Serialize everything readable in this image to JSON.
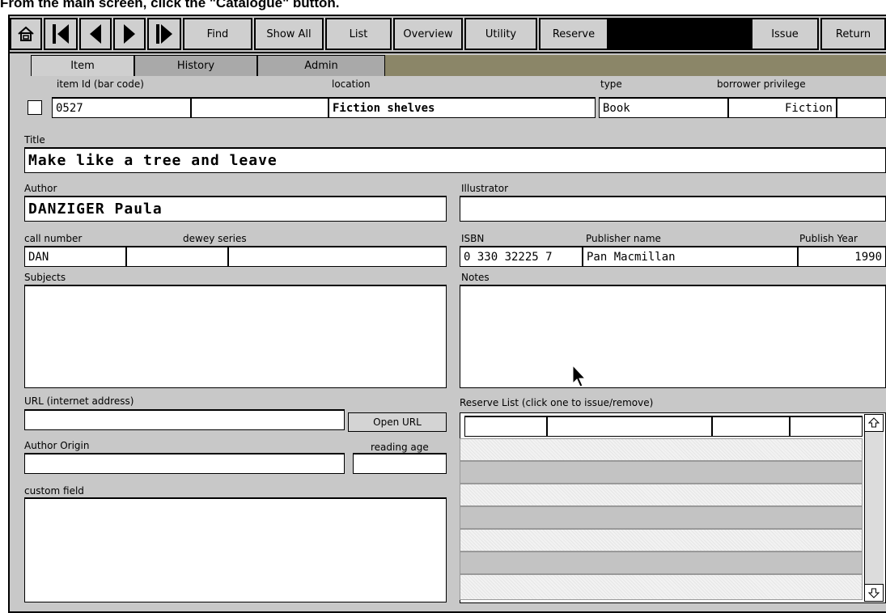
{
  "caption": "From the main screen, click the \"Catalogue\" button.",
  "toolbar": {
    "find": "Find",
    "show_all": "Show All",
    "list": "List",
    "overview": "Overview",
    "utility": "Utility",
    "reserve": "Reserve",
    "issue": "Issue",
    "return": "Return"
  },
  "tabs": {
    "item": "Item",
    "history": "History",
    "admin": "Admin"
  },
  "item": {
    "id_label": "item Id (bar code)",
    "id_value": "0527",
    "location_label": "location",
    "location_value": "Fiction shelves",
    "type_label": "type",
    "type_value": "Book",
    "privilege_label": "borrower privilege",
    "privilege_value": "Fiction"
  },
  "title": {
    "label": "Title",
    "value": "Make like a tree and leave"
  },
  "author": {
    "label": "Author",
    "value": "DANZIGER  Paula"
  },
  "illustrator": {
    "label": "Illustrator",
    "value": ""
  },
  "call": {
    "label": "call number",
    "value": "DAN",
    "dewey_label": "dewey series"
  },
  "isbn": {
    "label": "ISBN",
    "value": "0 330 32225 7"
  },
  "publisher": {
    "label": "Publisher name",
    "value": "Pan Macmillan"
  },
  "year": {
    "label": "Publish Year",
    "value": "1990"
  },
  "subjects": {
    "label": "Subjects"
  },
  "notes": {
    "label": "Notes"
  },
  "url": {
    "label": "URL (internet address)",
    "button": "Open URL"
  },
  "origin": {
    "label": "Author Origin"
  },
  "reading": {
    "label": "reading age"
  },
  "custom": {
    "label": "custom field"
  },
  "reserve_list": {
    "label": "Reserve List (click one to issue/remove)"
  },
  "colors": {
    "window_bg": "#c8c8c8",
    "tab_strip": "#8b8668",
    "field_bg": "#ffffff"
  },
  "icons": [
    "home-icon",
    "first-record-icon",
    "previous-record-icon",
    "next-record-icon",
    "last-record-icon",
    "mouse-pointer-icon",
    "scroll-up-icon",
    "scroll-down-icon"
  ]
}
